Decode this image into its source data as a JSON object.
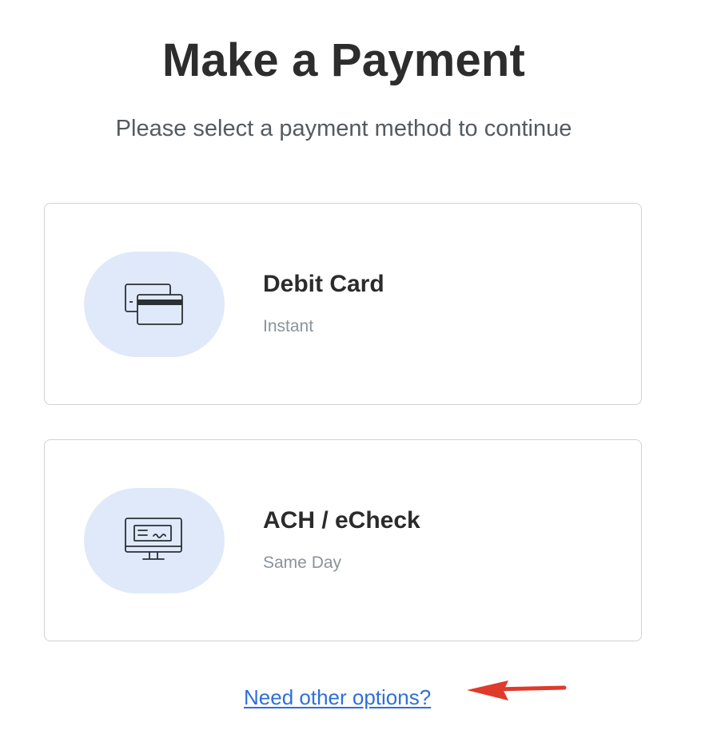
{
  "header": {
    "title": "Make a Payment",
    "subtitle": "Please select a payment method to continue"
  },
  "payment_methods": [
    {
      "title": "Debit Card",
      "speed": "Instant",
      "icon": "credit-card-icon"
    },
    {
      "title": "ACH / eCheck",
      "speed": "Same Day",
      "icon": "computer-check-icon"
    }
  ],
  "footer": {
    "other_options_label": "Need other options?"
  },
  "colors": {
    "icon_background": "#dfe9fa",
    "link": "#2f6fd8",
    "annotation_arrow": "#e03a2a",
    "card_border": "#cfd2d6"
  }
}
